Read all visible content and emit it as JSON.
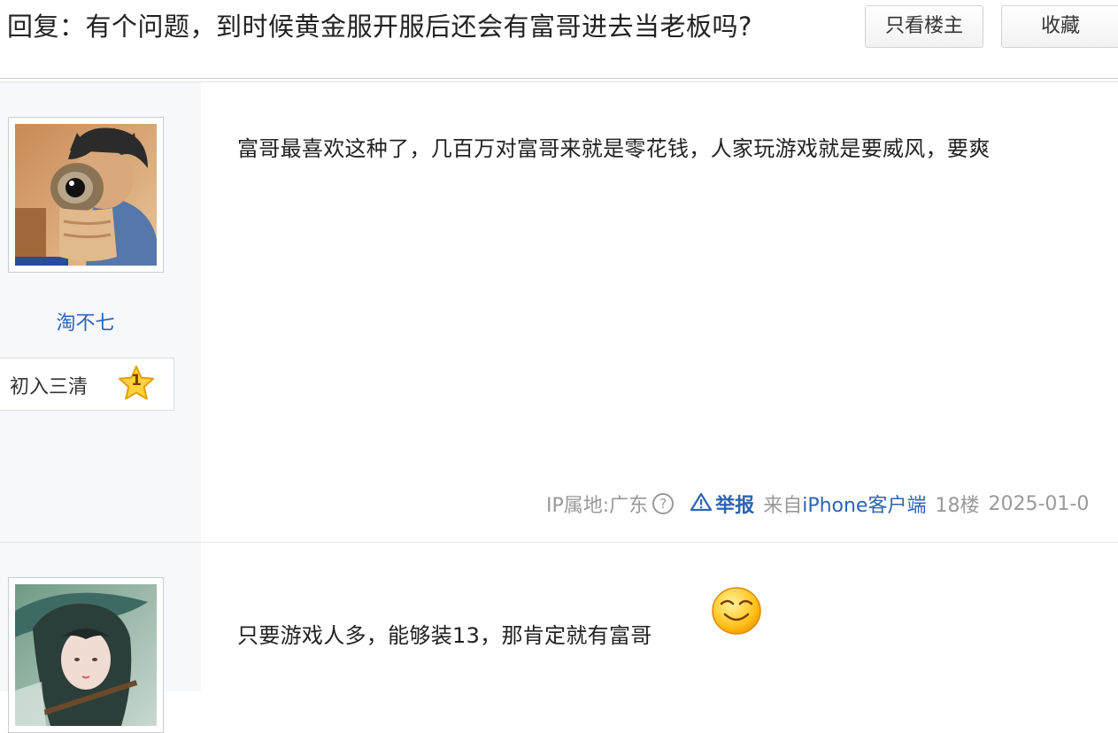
{
  "header": {
    "title": "回复：有个问题，到时候黄金服开服后还会有富哥进去当老板吗?",
    "only_op_label": "只看楼主",
    "favorite_label": "收藏"
  },
  "posts": [
    {
      "username": "淘不七",
      "level_name": "初入三清",
      "level_number": "1",
      "text": "富哥最喜欢这种了，几百万对富哥来就是零花钱，人家玩游戏就是要威风，要爽",
      "ip_location": "IP属地:广东",
      "help_glyph": "?",
      "report_label": "举报",
      "client_prefix": "来自",
      "client_name": "iPhone客户端",
      "floor": "18楼",
      "date": "2025-01-0"
    },
    {
      "text": "只要游戏人多，能够装13，那肯定就有富哥"
    }
  ],
  "colors": {
    "link": "#2d64b3",
    "sidebar_bg": "#f6f8fb",
    "meta_text": "#999999"
  },
  "icons": {
    "report": "warning-triangle-icon",
    "help": "question-circle-icon",
    "level": "star-icon",
    "emoji": "grinning-face-icon"
  }
}
